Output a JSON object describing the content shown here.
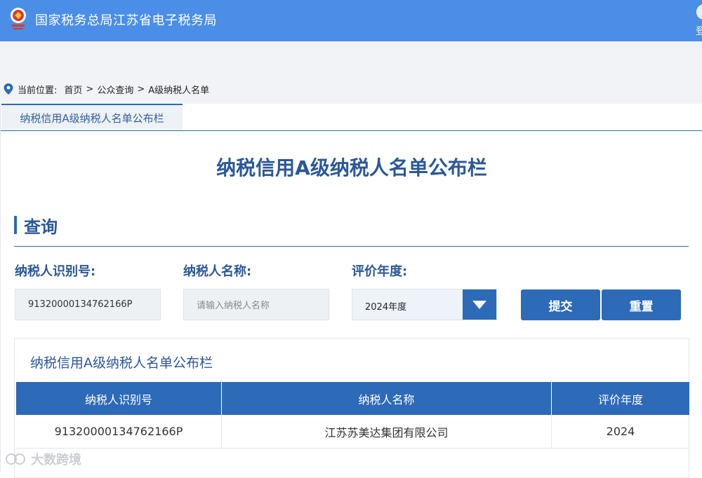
{
  "header": {
    "title": "国家税务总局江苏省电子税务局",
    "login_label": "登",
    "logo_icon": "tax-emblem-icon"
  },
  "breadcrumb": {
    "label": "当前位置:",
    "items": [
      "首页",
      "公众查询",
      "A级纳税人名单"
    ],
    "separator": ">"
  },
  "tab": {
    "label": "纳税信用A级纳税人名单公布栏"
  },
  "page_title": "纳税信用A级纳税人名单公布栏",
  "query": {
    "section_title": "查询",
    "taxpayer_id_label": "纳税人识别号:",
    "taxpayer_id_value": "91320000134762166P",
    "taxpayer_name_label": "纳税人名称:",
    "taxpayer_name_placeholder": "请输入纳税人名称",
    "year_label": "评价年度:",
    "year_value": "2024年度",
    "submit_label": "提交",
    "reset_label": "重置"
  },
  "results": {
    "panel_title": "纳税信用A级纳税人名单公布栏",
    "columns": [
      "纳税人识别号",
      "纳税人名称",
      "评价年度"
    ],
    "rows": [
      [
        "91320000134762166P",
        "江苏苏美达集团有限公司",
        "2024"
      ]
    ]
  },
  "watermark": {
    "text": "大数跨境"
  },
  "colors": {
    "header_bg": "#4a8ee8",
    "accent": "#2d6ab8",
    "title_text": "#2b5897"
  }
}
